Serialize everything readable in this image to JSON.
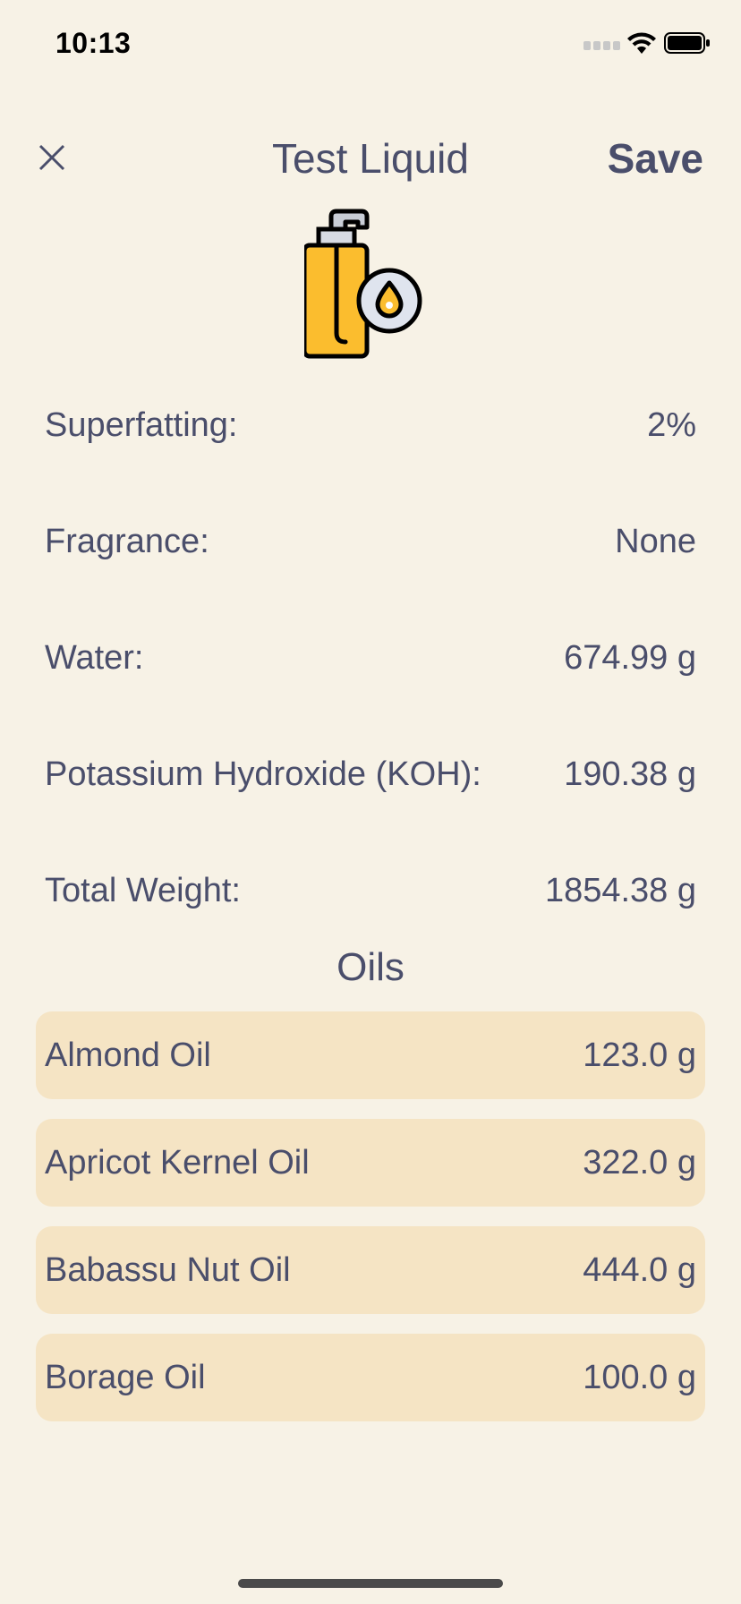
{
  "status_bar": {
    "time": "10:13"
  },
  "nav": {
    "title": "Test Liquid",
    "save_label": "Save"
  },
  "hero": {
    "icon": "liquid-soap-pump-bottle-icon",
    "bottle_color": "#fbbd2e"
  },
  "details": [
    {
      "label": "Superfatting:",
      "value": "2%"
    },
    {
      "label": "Fragrance:",
      "value": "None"
    },
    {
      "label": "Water:",
      "value": "674.99 g"
    },
    {
      "label": "Potassium Hydroxide (KOH):",
      "value": "190.38 g"
    },
    {
      "label": "Total Weight:",
      "value": "1854.38 g"
    }
  ],
  "oils_section": {
    "title": "Oils",
    "items": [
      {
        "name": "Almond Oil",
        "weight": "123.0 g"
      },
      {
        "name": "Apricot Kernel Oil",
        "weight": "322.0 g"
      },
      {
        "name": "Babassu Nut Oil",
        "weight": "444.0 g"
      },
      {
        "name": "Borage Oil",
        "weight": "100.0 g"
      }
    ]
  },
  "colors": {
    "background": "#f7f2e6",
    "text": "#4a4e6b",
    "oil_row": "#f5e4c4"
  }
}
